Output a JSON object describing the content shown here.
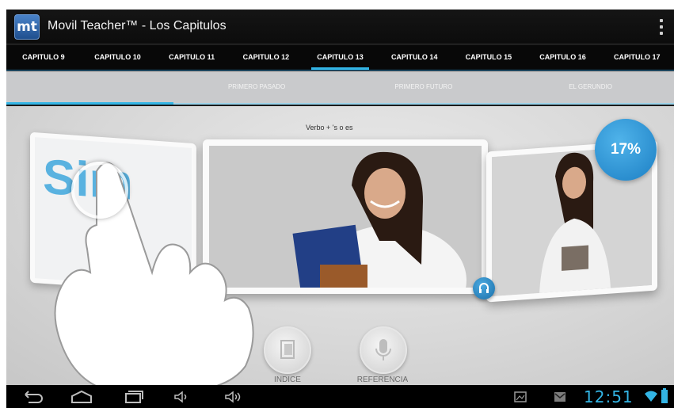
{
  "app": {
    "logo_text": "mt",
    "title": "Movil Teacher™ - Los Capitulos"
  },
  "chapters": [
    {
      "label": "CAPITULO 9"
    },
    {
      "label": "CAPITULO 10"
    },
    {
      "label": "CAPITULO 11"
    },
    {
      "label": "CAPITULO 12"
    },
    {
      "label": "CAPITULO 13",
      "active": true
    },
    {
      "label": "CAPITULO 14"
    },
    {
      "label": "CAPITULO 15"
    },
    {
      "label": "CAPITULO 16"
    },
    {
      "label": "CAPITULO 17"
    }
  ],
  "subtabs": [
    {
      "label": "",
      "active": true
    },
    {
      "label": "PRIMERO PASADO"
    },
    {
      "label": "PRIMERO FUTURO"
    },
    {
      "label": "EL GERUNDIO"
    }
  ],
  "content": {
    "subtitle": "Verbo + 's  o es",
    "left_card_text": "Sim",
    "progress_label": "17%",
    "progress_value": 0.17
  },
  "buttons": {
    "indice_label": "INDICE",
    "referencia_label": "REFERENCIA"
  },
  "status": {
    "clock": "12:51"
  },
  "colors": {
    "accent": "#33b5e5",
    "bubble": "#1c7fc4"
  }
}
